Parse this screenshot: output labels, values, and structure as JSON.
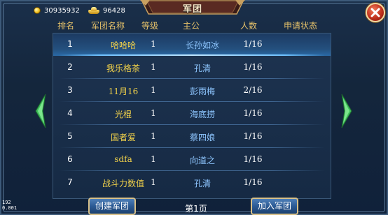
{
  "currency": {
    "coins": {
      "icon": "gold-coin-icon",
      "value": "30935932"
    },
    "ingots": {
      "icon": "gold-ingot-icon",
      "value": "96428"
    }
  },
  "title": "军团",
  "close": {
    "icon": "close-icon"
  },
  "headers": {
    "rank": "排名",
    "name": "军团名称",
    "level": "等级",
    "leader": "主公",
    "members": "人数",
    "status": "申请状态"
  },
  "rows": [
    {
      "rank": "1",
      "name": "哈哈哈",
      "level": "1",
      "leader": "长孙如冰",
      "members": "1/16"
    },
    {
      "rank": "2",
      "name": "我乐格茶",
      "level": "1",
      "leader": "孔清",
      "members": "1/16"
    },
    {
      "rank": "3",
      "name": "11月16",
      "level": "1",
      "leader": "彭雨梅",
      "members": "2/16"
    },
    {
      "rank": "4",
      "name": "光棍",
      "level": "1",
      "leader": "海底捞",
      "members": "1/16"
    },
    {
      "rank": "5",
      "name": "国者爱",
      "level": "1",
      "leader": "蔡四娘",
      "members": "1/16"
    },
    {
      "rank": "6",
      "name": "sdfa",
      "level": "1",
      "leader": "向道之",
      "members": "1/16"
    },
    {
      "rank": "7",
      "name": "战斗力数值",
      "level": "1",
      "leader": "孔清",
      "members": "1/16"
    }
  ],
  "nav": {
    "prev_icon": "arrow-left-icon",
    "next_icon": "arrow-right-icon"
  },
  "footer": {
    "create_button": "创建军团",
    "page": "第1页",
    "join_button": "加入军团"
  },
  "debug": {
    "line1": "192",
    "line2": "0.001"
  },
  "colors": {
    "header_text": "#e6c26a",
    "legion_name": "#f2d24a",
    "leader_name": "#8ec6ff",
    "panel_bg": "#162a44",
    "selected_row": "#24507e"
  }
}
